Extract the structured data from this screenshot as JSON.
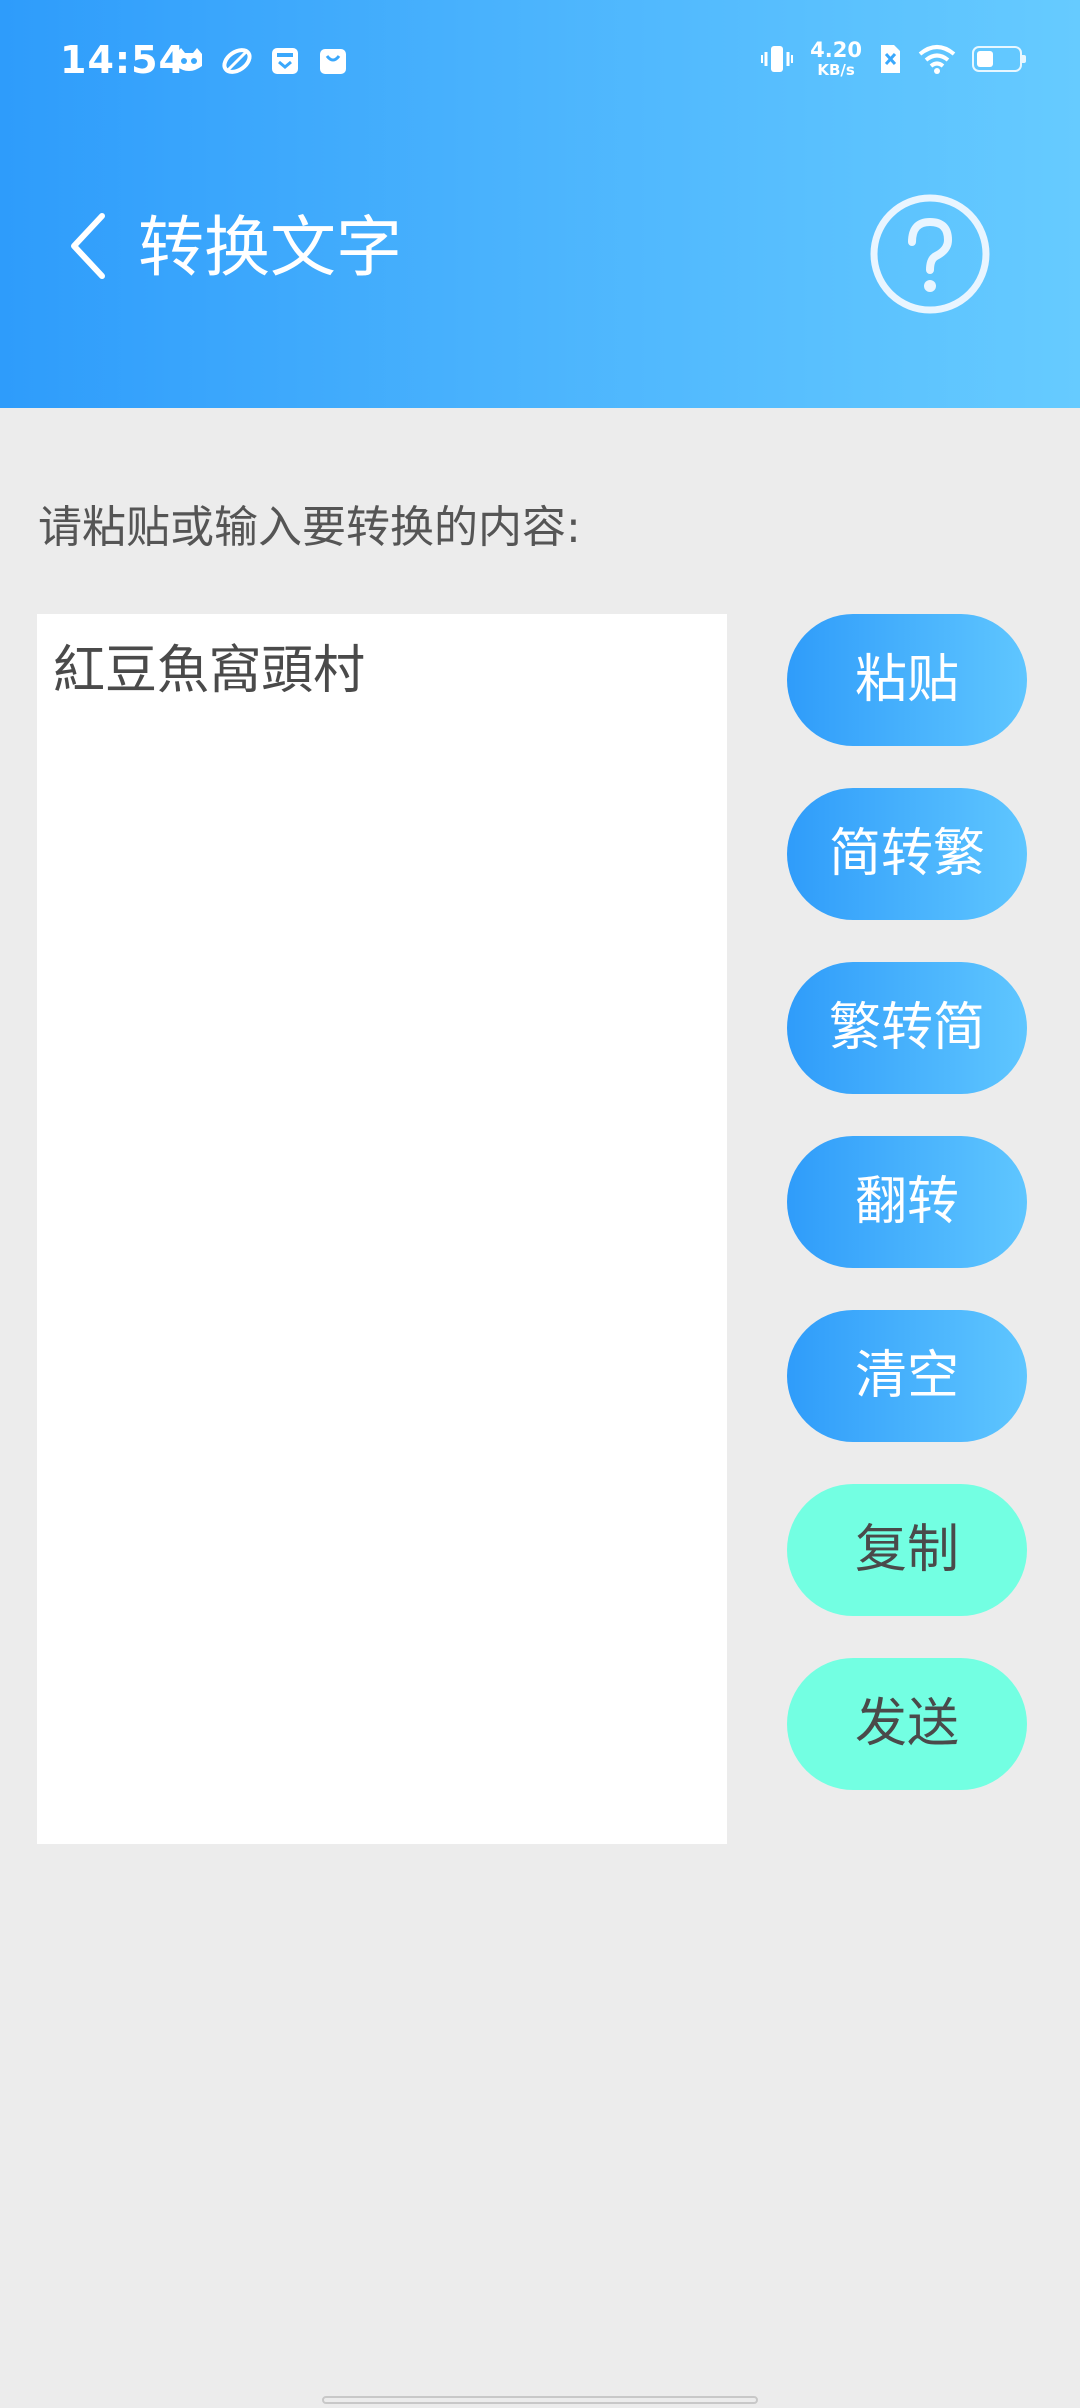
{
  "status_bar": {
    "time": "14:54",
    "notification_icons": [
      "cat-icon",
      "leaf-icon",
      "inbox-icon",
      "shopping-bag-icon"
    ],
    "network_speed_value": "4.20",
    "network_speed_unit": "KB/s",
    "system_icons": [
      "vibrate-icon",
      "sim-x-icon",
      "wifi-icon",
      "battery-icon"
    ]
  },
  "header": {
    "back_icon": "chevron-left-icon",
    "title": "转换文字",
    "help_icon": "question-circle-icon"
  },
  "main": {
    "prompt": "请粘贴或输入要转换的内容:",
    "input_value": "紅豆魚窩頭村",
    "buttons": [
      {
        "label": "粘贴",
        "style": "blue"
      },
      {
        "label": "简转繁",
        "style": "blue"
      },
      {
        "label": "繁转简",
        "style": "blue"
      },
      {
        "label": "翻转",
        "style": "blue"
      },
      {
        "label": "清空",
        "style": "blue"
      },
      {
        "label": "复制",
        "style": "mint"
      },
      {
        "label": "发送",
        "style": "mint"
      }
    ]
  },
  "colors": {
    "header_gradient_start": "#2e9cfb",
    "header_gradient_end": "#66cbff",
    "button_blue_start": "#2f9cfa",
    "button_blue_end": "#5fc6ff",
    "button_mint": "#73ffe2",
    "background": "#ececec"
  }
}
